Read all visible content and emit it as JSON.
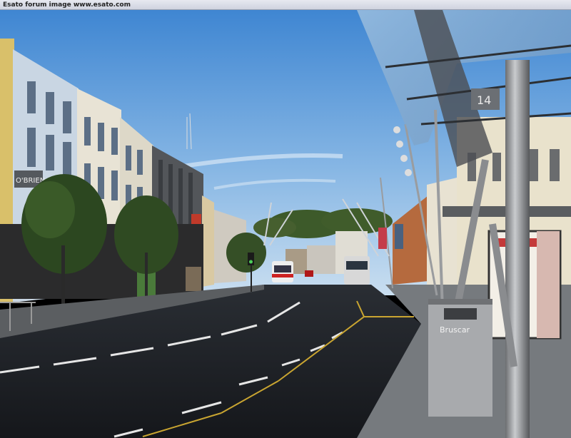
{
  "watermark": "Esato forum image www.esato.com",
  "signs": {
    "shop_left": "O'BRIEN",
    "bin_brand": "Bruscar",
    "shelter_number": "14"
  },
  "colors": {
    "sky_top": "#4a8fd6",
    "sky_bottom": "#b9d6ee",
    "road": "#1c1f24",
    "pavement": "#6b6e72",
    "building_cream": "#e7e3d6",
    "building_blue": "#cdd8e3",
    "tree": "#2f4a22",
    "shelter_glass": "#8fb2d6",
    "pole_metal": "#9a9c9f"
  }
}
